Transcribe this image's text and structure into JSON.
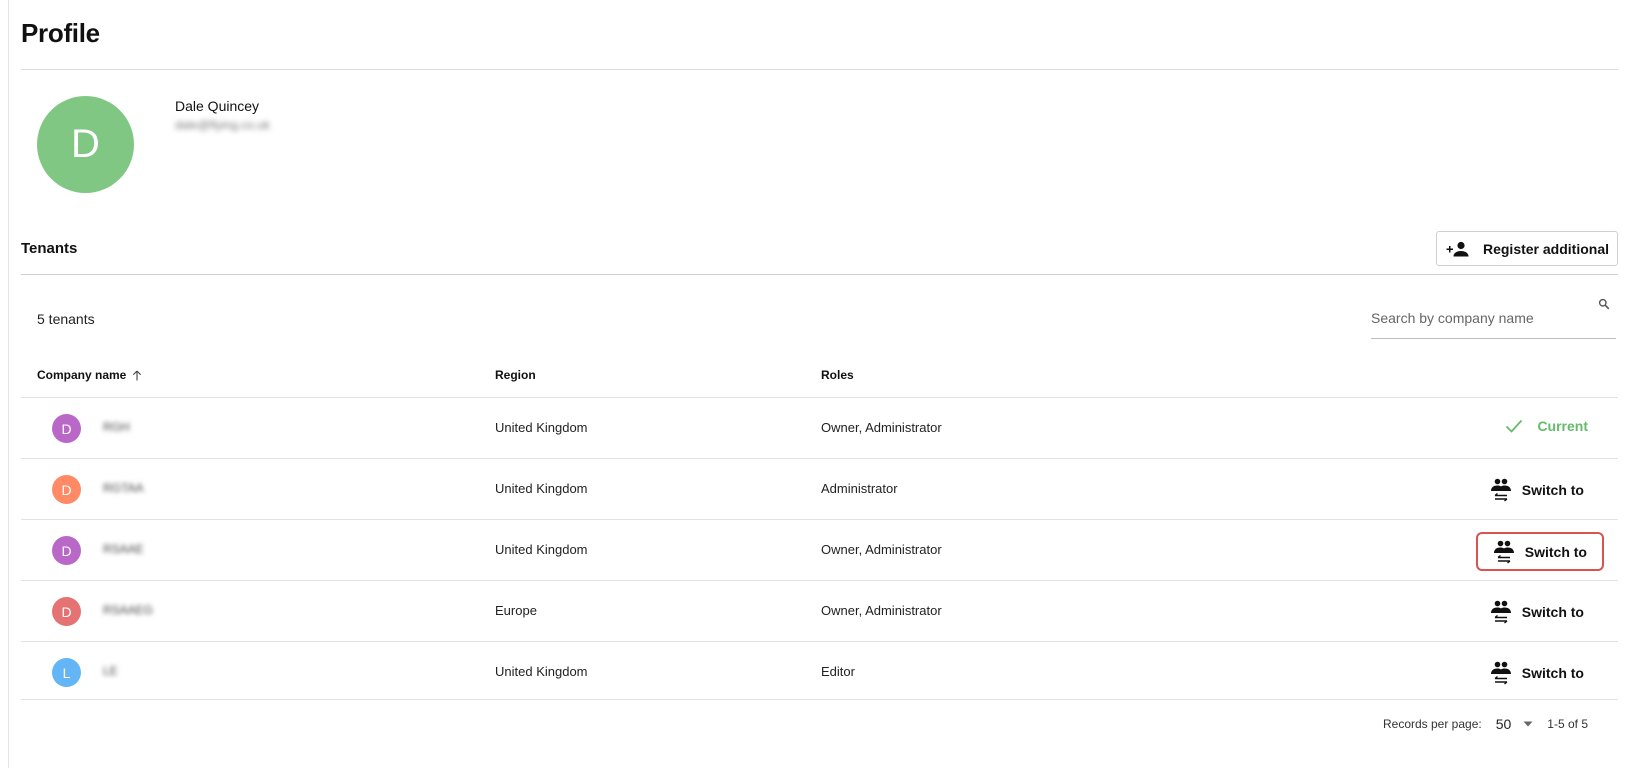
{
  "page": {
    "title": "Profile"
  },
  "profile": {
    "avatar_letter": "D",
    "avatar_color": "#81c784",
    "name": "Dale Quincey",
    "email": "dale@flying.co.uk"
  },
  "tenants_section": {
    "title": "Tenants",
    "register_label": "Register additional",
    "count_text": "5 tenants",
    "search_placeholder": "Search by company name"
  },
  "table": {
    "headers": {
      "company": "Company name",
      "region": "Region",
      "roles": "Roles"
    },
    "sort": {
      "column": "company",
      "direction": "ascending"
    },
    "rows": [
      {
        "letter": "D",
        "color": "#ba68c8",
        "company": "RGH",
        "region": "United Kingdom",
        "roles": "Owner, Administrator",
        "action": "Current"
      },
      {
        "letter": "D",
        "color": "#ff8a65",
        "company": "RGTAA",
        "region": "United Kingdom",
        "roles": "Administrator",
        "action": "Switch to"
      },
      {
        "letter": "D",
        "color": "#ba68c8",
        "company": "RSAAE",
        "region": "United Kingdom",
        "roles": "Owner, Administrator",
        "action": "Switch to"
      },
      {
        "letter": "D",
        "color": "#e57373",
        "company": "RSAAEG",
        "region": "Europe",
        "roles": "Owner, Administrator",
        "action": "Switch to"
      },
      {
        "letter": "L",
        "color": "#64b5f6",
        "company": "LE",
        "region": "United Kingdom",
        "roles": "Editor",
        "action": "Switch to"
      }
    ]
  },
  "pagination": {
    "records_per_page_label": "Records per page:",
    "records_per_page_value": "50",
    "range_text": "1-5 of 5"
  },
  "colors": {
    "current": "#66bb6a",
    "highlight_border": "#d9534f"
  }
}
